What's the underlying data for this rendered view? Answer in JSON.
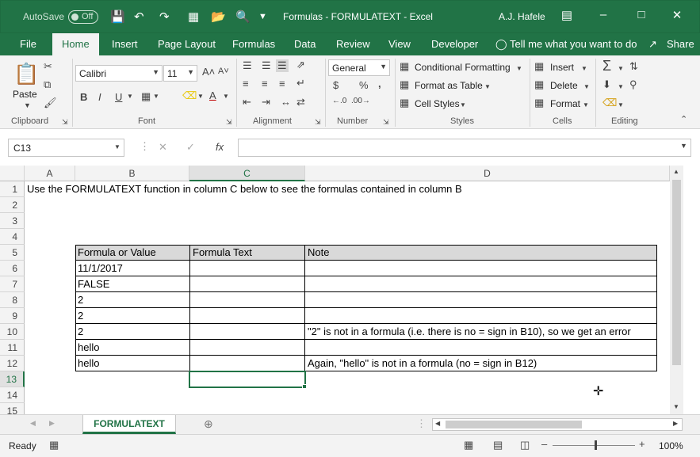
{
  "titlebar": {
    "autosave_label": "AutoSave",
    "autosave_state": "Off",
    "title": "Formulas - FORMULATEXT  -  Excel",
    "user": "A.J. Hafele"
  },
  "tabs": [
    "File",
    "Home",
    "Insert",
    "Page Layout",
    "Formulas",
    "Data",
    "Review",
    "View",
    "Developer"
  ],
  "tell_me": "Tell me what you want to do",
  "share": "Share",
  "ribbon": {
    "paste": "Paste",
    "font_name": "Calibri",
    "font_size": "11",
    "number_format": "General",
    "conditional_formatting": "Conditional Formatting",
    "format_as_table": "Format as Table",
    "cell_styles": "Cell Styles",
    "insert": "Insert",
    "delete": "Delete",
    "format": "Format",
    "groups": {
      "clipboard": "Clipboard",
      "font": "Font",
      "alignment": "Alignment",
      "number": "Number",
      "styles": "Styles",
      "cells": "Cells",
      "editing": "Editing"
    }
  },
  "formula_bar": {
    "name_box": "C13",
    "fx": "fx",
    "value": ""
  },
  "columns": [
    "A",
    "B",
    "C",
    "D"
  ],
  "rows": [
    "1",
    "2",
    "3",
    "4",
    "5",
    "6",
    "7",
    "8",
    "9",
    "10",
    "11",
    "12",
    "13",
    "14",
    "15"
  ],
  "cells": {
    "A1": "Use the FORMULATEXT function in column C below to see the formulas contained in column B",
    "B5": "Formula or Value",
    "C5": "Formula Text",
    "D5": "Note",
    "B6": "11/1/2017",
    "B7": "FALSE",
    "B8": "2",
    "B9": "2",
    "B10": "2",
    "D10": "\"2\" is not in a formula (i.e. there is no = sign in B10), so we get an error",
    "B11": "hello",
    "B12": "hello",
    "D12": "Again, \"hello\" is not in a formula (no = sign in B12)"
  },
  "sheet_tab": "FORMULATEXT",
  "status": {
    "ready": "Ready",
    "zoom": "100%"
  }
}
